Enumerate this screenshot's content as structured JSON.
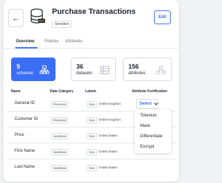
{
  "header": {
    "title": "Purchase Transactions",
    "badge": "Sensitive",
    "aws_label": "aws",
    "edit_label": "Edit"
  },
  "tabs": [
    {
      "label": "Overview",
      "active": true
    },
    {
      "label": "Policies",
      "active": false
    },
    {
      "label": "Attributes",
      "active": false
    }
  ],
  "stats": [
    {
      "value": "5",
      "label": "schemas",
      "icon": "schema-tree-icon",
      "active": true
    },
    {
      "value": "36",
      "label": "datasets",
      "icon": "table-icon",
      "active": false
    },
    {
      "value": "156",
      "label": "attributes",
      "icon": "nodes-icon",
      "active": false
    }
  ],
  "table": {
    "columns": [
      "Name",
      "Data Category",
      "Labels",
      "Attribute Fortification"
    ],
    "rows": [
      {
        "name": "General ID",
        "category": "Personal",
        "tag": "Geo",
        "region": "United Kingdom"
      },
      {
        "name": "Customer ID",
        "category": "Personal",
        "tag": "Geo",
        "region": "United Kingdom"
      },
      {
        "name": "Price",
        "category": "Sensitive",
        "tag": "Geo",
        "region": "United States"
      },
      {
        "name": "First Name",
        "category": "Sensitive",
        "tag": "Geo",
        "region": "United States"
      },
      {
        "name": "Last Name",
        "category": "Sensitive",
        "tag": "Geo",
        "region": "United States"
      }
    ]
  },
  "select": {
    "label": "Select",
    "options": [
      "Tokenize",
      "Mask",
      "Differentiate",
      "Encrypt"
    ]
  },
  "colors": {
    "accent": "#3b6ef6",
    "text": "#1d2230"
  }
}
